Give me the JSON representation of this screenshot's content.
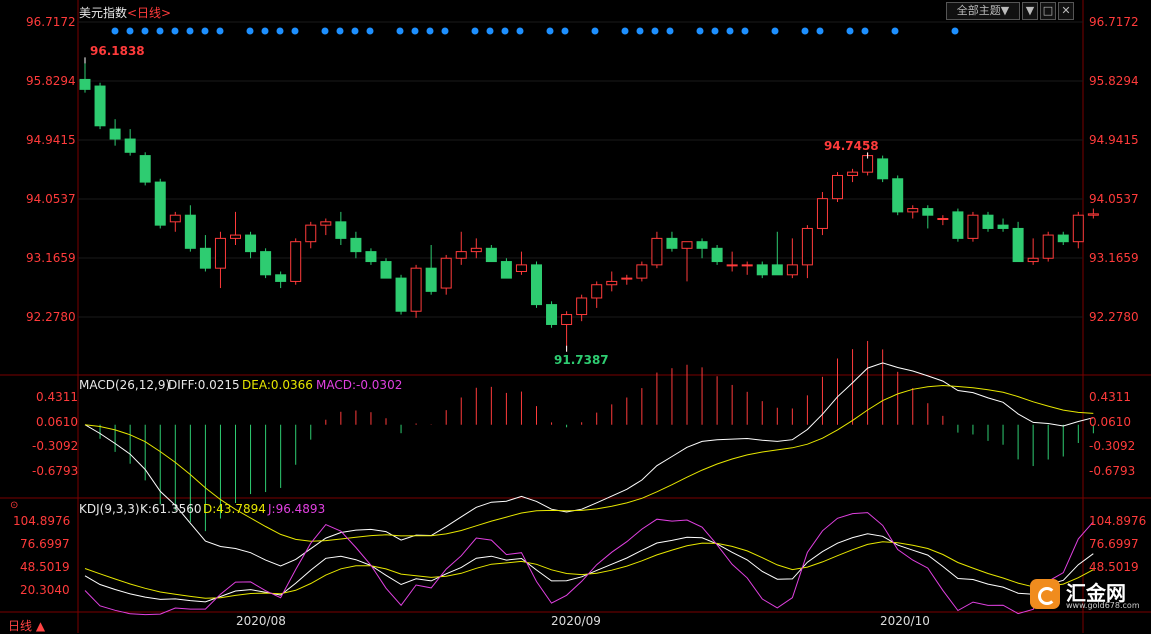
{
  "header": {
    "instrument": "美元指数",
    "timeframe_link": "<日线>",
    "theme_button": "全部主题▼",
    "win_buttons": [
      "▼",
      "□",
      "✕"
    ]
  },
  "main_panel": {
    "y_ticks": [
      "96.7172",
      "95.8294",
      "94.9415",
      "94.0537",
      "93.1659",
      "92.2780"
    ],
    "annotations": {
      "high_start": "96.1838",
      "peak": "94.7458",
      "low": "91.7387"
    }
  },
  "macd_panel": {
    "label": "MACD(26,12,9)",
    "diff": "DIFF:0.0215",
    "dea": "DEA:0.0366",
    "macd": "MACD:-0.0302",
    "y_ticks": [
      "0.4311",
      "0.0610",
      "-0.3092",
      "-0.6793"
    ]
  },
  "kdj_panel": {
    "label": "KDJ(9,3,3)",
    "k": "K:61.3560",
    "d": "D:43.7894",
    "j": "J:96.4893",
    "y_ticks": [
      "104.8976",
      "76.6997",
      "48.5019",
      "20.3040"
    ]
  },
  "x_axis": {
    "ticks": [
      "2020/08",
      "2020/09",
      "2020/10"
    ]
  },
  "footer": {
    "timeframe": "日线 ▲"
  },
  "logo": {
    "name": "汇金网",
    "url": "www.gold678.com"
  },
  "colors": {
    "up": "#ff3b3b",
    "down": "#2ecc71",
    "background": "#000000",
    "dot": "#1e90ff",
    "diff_line": "#ffffff",
    "dea_line": "#e6e600",
    "j_line": "#e040e0"
  },
  "chart_data": {
    "type": "candlestick",
    "title": "美元指数",
    "ohlc": [
      [
        95.85,
        96.18,
        95.65,
        95.7
      ],
      [
        95.75,
        95.8,
        95.1,
        95.15
      ],
      [
        95.1,
        95.25,
        94.85,
        94.95
      ],
      [
        94.95,
        95.1,
        94.7,
        94.75
      ],
      [
        94.7,
        94.75,
        94.25,
        94.3
      ],
      [
        94.3,
        94.35,
        93.6,
        93.65
      ],
      [
        93.7,
        93.85,
        93.55,
        93.8
      ],
      [
        93.8,
        93.95,
        93.25,
        93.3
      ],
      [
        93.3,
        93.5,
        92.95,
        93.0
      ],
      [
        93.0,
        93.55,
        92.7,
        93.45
      ],
      [
        93.45,
        93.85,
        93.35,
        93.5
      ],
      [
        93.5,
        93.55,
        93.15,
        93.25
      ],
      [
        93.25,
        93.3,
        92.85,
        92.9
      ],
      [
        92.9,
        92.95,
        92.7,
        92.8
      ],
      [
        92.8,
        93.45,
        92.75,
        93.4
      ],
      [
        93.4,
        93.7,
        93.3,
        93.65
      ],
      [
        93.65,
        93.75,
        93.5,
        93.7
      ],
      [
        93.7,
        93.85,
        93.35,
        93.45
      ],
      [
        93.45,
        93.55,
        93.15,
        93.25
      ],
      [
        93.25,
        93.3,
        93.05,
        93.1
      ],
      [
        93.1,
        93.15,
        92.85,
        92.85
      ],
      [
        92.85,
        92.9,
        92.3,
        92.35
      ],
      [
        92.35,
        93.05,
        92.25,
        93.0
      ],
      [
        93.0,
        93.35,
        92.6,
        92.65
      ],
      [
        92.7,
        93.2,
        92.6,
        93.15
      ],
      [
        93.15,
        93.55,
        93.05,
        93.25
      ],
      [
        93.25,
        93.45,
        93.15,
        93.3
      ],
      [
        93.3,
        93.35,
        93.1,
        93.1
      ],
      [
        93.1,
        93.15,
        92.85,
        92.85
      ],
      [
        92.95,
        93.25,
        92.9,
        93.05
      ],
      [
        93.05,
        93.1,
        92.4,
        92.45
      ],
      [
        92.45,
        92.5,
        92.1,
        92.15
      ],
      [
        92.15,
        92.35,
        91.74,
        92.3
      ],
      [
        92.3,
        92.6,
        92.2,
        92.55
      ],
      [
        92.55,
        92.8,
        92.4,
        92.75
      ],
      [
        92.75,
        92.95,
        92.65,
        92.8
      ],
      [
        92.85,
        92.9,
        92.75,
        92.85
      ],
      [
        92.85,
        93.1,
        92.8,
        93.05
      ],
      [
        93.05,
        93.55,
        93.0,
        93.45
      ],
      [
        93.45,
        93.55,
        93.25,
        93.3
      ],
      [
        93.3,
        93.35,
        92.8,
        93.4
      ],
      [
        93.4,
        93.45,
        93.15,
        93.3
      ],
      [
        93.3,
        93.35,
        93.05,
        93.1
      ],
      [
        93.05,
        93.25,
        92.95,
        93.05
      ],
      [
        93.05,
        93.1,
        92.9,
        93.05
      ],
      [
        93.05,
        93.1,
        92.85,
        92.9
      ],
      [
        93.05,
        93.55,
        92.9,
        92.9
      ],
      [
        92.9,
        93.45,
        92.85,
        93.05
      ],
      [
        93.05,
        93.65,
        92.85,
        93.6
      ],
      [
        93.6,
        94.15,
        93.5,
        94.05
      ],
      [
        94.05,
        94.45,
        94.0,
        94.4
      ],
      [
        94.4,
        94.5,
        94.3,
        94.45
      ],
      [
        94.45,
        94.75,
        94.4,
        94.7
      ],
      [
        94.65,
        94.7,
        94.3,
        94.35
      ],
      [
        94.35,
        94.4,
        93.8,
        93.85
      ],
      [
        93.85,
        93.95,
        93.75,
        93.9
      ],
      [
        93.9,
        93.95,
        93.6,
        93.8
      ],
      [
        93.75,
        93.8,
        93.65,
        93.75
      ],
      [
        93.85,
        93.9,
        93.4,
        93.45
      ],
      [
        93.45,
        93.85,
        93.4,
        93.8
      ],
      [
        93.8,
        93.85,
        93.55,
        93.6
      ],
      [
        93.65,
        93.75,
        93.55,
        93.6
      ],
      [
        93.6,
        93.7,
        93.1,
        93.1
      ],
      [
        93.1,
        93.45,
        93.05,
        93.15
      ],
      [
        93.15,
        93.55,
        93.1,
        93.5
      ],
      [
        93.5,
        93.55,
        93.35,
        93.4
      ],
      [
        93.4,
        93.85,
        93.3,
        93.8
      ],
      [
        93.8,
        93.9,
        93.75,
        93.82
      ]
    ],
    "high_label": 96.1838,
    "peak_label": 94.7458,
    "low_label": 91.7387,
    "ylim": [
      91.7,
      96.72
    ],
    "macd": {
      "ylim": [
        -0.85,
        0.6
      ],
      "diff_last": 0.0215,
      "dea_last": 0.0366,
      "macd_last": -0.0302
    },
    "kdj": {
      "ylim": [
        5,
        112
      ],
      "k_last": 61.356,
      "d_last": 43.7894,
      "j_last": 96.4893
    },
    "x_ticks": [
      {
        "label": "2020/08",
        "index": 13
      },
      {
        "label": "2020/09",
        "index": 38
      },
      {
        "label": "2020/10",
        "index": 66
      }
    ],
    "legend_position": "top-left"
  }
}
